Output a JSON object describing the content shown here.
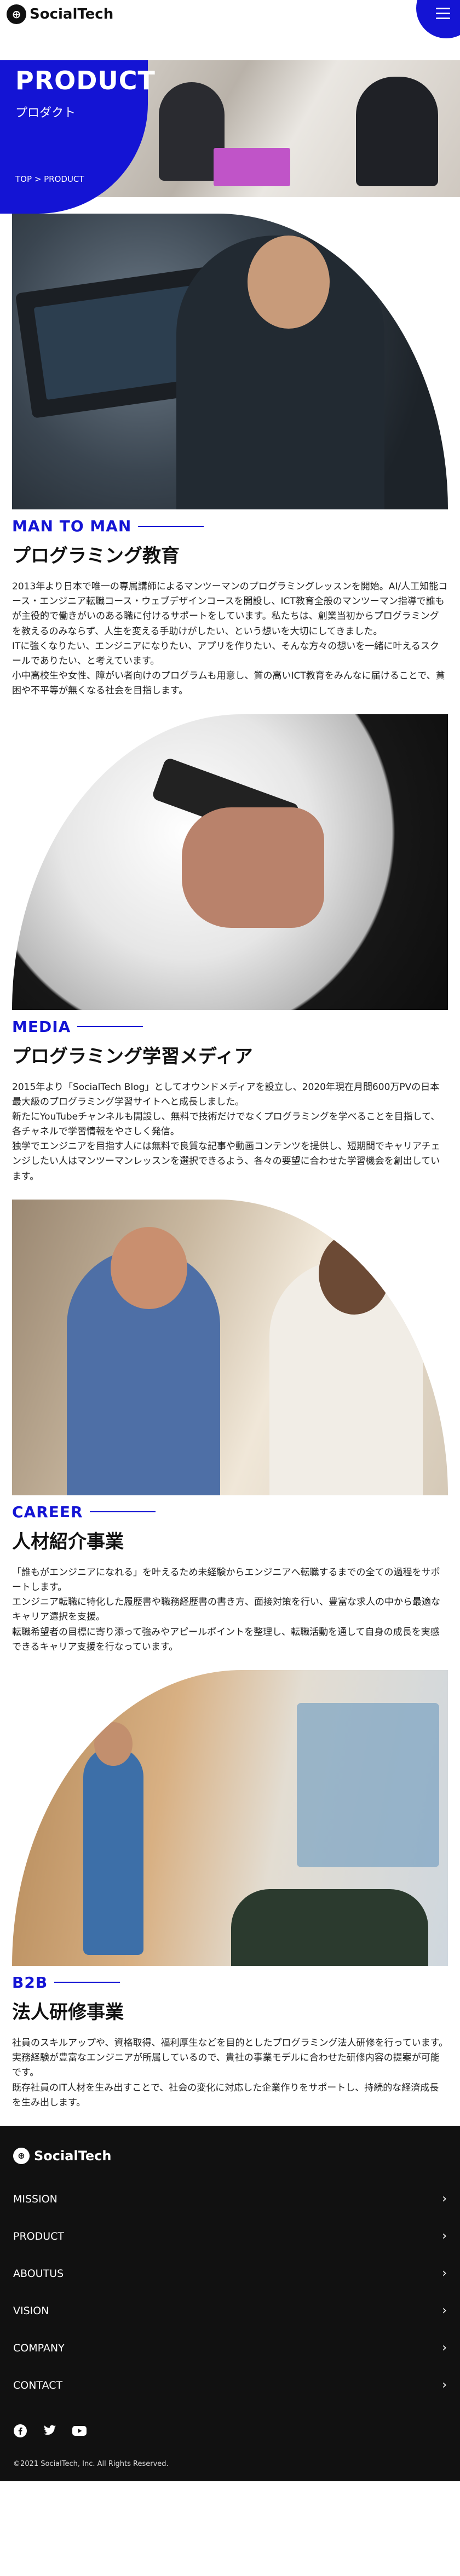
{
  "brand": {
    "name": "SocialTech",
    "accent": "#1414d4"
  },
  "hero": {
    "title": "PRODUCT",
    "subtitle": "プロダクト",
    "breadcrumb": {
      "home": "TOP",
      "separator": " > ",
      "current": "PRODUCT"
    }
  },
  "sections": [
    {
      "label": "MAN TO MAN",
      "title": "プログラミング教育",
      "body": [
        "2013年より日本で唯一の専属講師によるマンツーマンのプログラミングレッスンを開始。AI/人工知能コース・エンジニア転職コース・ウェブデザインコースを開設し、ICT教育全般のマンツーマン指導で誰もが主役的で働きがいのある職に付けるサポートをしています。私たちは、創業当初からプログラミングを教えるのみならず、人生を変える手助けがしたい、という想いを大切にしてきました。",
        "ITに強くなりたい、エンジニアになりたい、アプリを作りたい、そんな方々の想いを一緒に叶えるスクールでありたい、と考えています。",
        "小中高校生や女性、障がい者向けのプログラムも用意し、質の高いICT教育をみんなに届けることで、貧困や不平等が無くなる社会を目指します。"
      ]
    },
    {
      "label": "MEDIA",
      "title": "プログラミング学習メディア",
      "body": [
        "2015年より「SocialTech Blog」としてオウンドメディアを設立し、2020年現在月間600万PVの日本最大級のプログラミング学習サイトへと成長しました。",
        "新たにYouTubeチャンネルも開設し、無料で技術だけでなくプログラミングを学べることを目指して、各チャネルで学習情報をやさしく発信。",
        "独学でエンジニアを目指す人には無料で良質な記事や動画コンテンツを提供し、短期間でキャリアチェンジしたい人はマンツーマンレッスンを選択できるよう、各々の要望に合わせた学習機会を創出しています。"
      ]
    },
    {
      "label": "CAREER",
      "title": "人材紹介事業",
      "body": [
        "「誰もがエンジニアになれる」を叶えるため未経験からエンジニアへ転職するまでの全ての過程をサポートします。",
        "エンジニア転職に特化した履歴書や職務経歴書の書き方、面接対策を行い、豊富な求人の中から最適なキャリア選択を支援。",
        "転職希望者の目標に寄り添って強みやアピールポイントを整理し、転職活動を通して自身の成長を実感できるキャリア支援を行なっています。"
      ]
    },
    {
      "label": "B2B",
      "title": "法人研修事業",
      "body": [
        "社員のスキルアップや、資格取得、福利厚生などを目的としたプログラミング法人研修を行っています。",
        "実務経験が豊富なエンジニアが所属しているので、貴社の事業モデルに合わせた研修内容の提案が可能です。",
        "既存社員のIT人材を生み出すことで、社会の変化に対応した企業作りをサポートし、持続的な経済成長を生み出します。"
      ]
    }
  ],
  "footer": {
    "brand": "SocialTech",
    "nav": [
      "MISSION",
      "PRODUCT",
      "ABOUTUS",
      "VISION",
      "COMPANY",
      "CONTACT"
    ],
    "social": [
      "facebook-icon",
      "twitter-icon",
      "youtube-icon"
    ],
    "copyright": "©2021 SocialTech, Inc. All Rights Reserved."
  }
}
